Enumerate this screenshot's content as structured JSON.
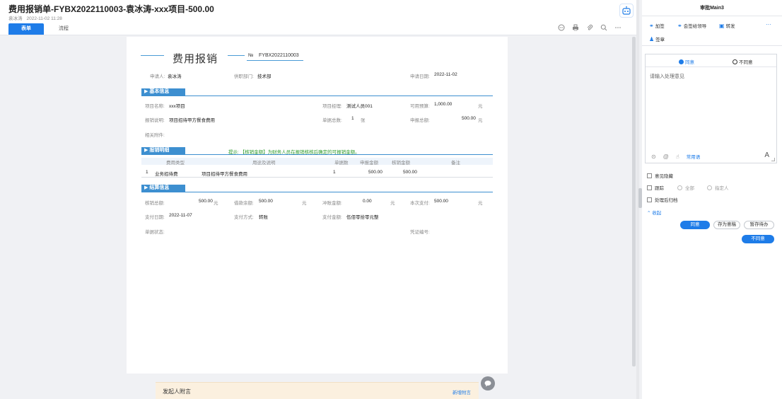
{
  "header": {
    "title": "费用报销单-FYBX2022110003-袁冰涛-xxx项目-500.00",
    "author": "袁冰涛",
    "datetime": "2022-11-02 11:28",
    "tabs": [
      {
        "label": "表单"
      },
      {
        "label": "流程"
      }
    ]
  },
  "form": {
    "title": "费用报销",
    "no_label": "№",
    "no_value": "FYBX2022110003",
    "applicant_label": "申请人:",
    "applicant": "袁冰涛",
    "department_label": "供职部门:",
    "department": "技术部",
    "apply_date_label": "申请日期:",
    "apply_date": "2022-11-02",
    "section_basic": "基本信息",
    "project_name_label": "项目名称:",
    "project_name": "xxx项目",
    "project_manager_label": "项目经理:",
    "project_manager": "测试人员001",
    "available_budget_label": "可用预算:",
    "available_budget": "1,000.00",
    "currency_unit": "元",
    "reason_label": "报销说明:",
    "reason": "项目招待甲方餐食费用",
    "bill_count_label": "单据总数:",
    "bill_count": "1",
    "bill_unit": "张",
    "declared_total_label": "申报总额:",
    "declared_total": "500.00",
    "attachment_label": "相关附件:",
    "section_detail": "报销明细",
    "hint": "提示: 【核销金额】为财务人员在报销核核后确定的可报销金额。",
    "detail_headers": [
      "费用类型",
      "用途及说明",
      "单据数",
      "申报金额",
      "核销金额",
      "备注"
    ],
    "detail_rows": [
      {
        "index": "1",
        "type": "业务招待费",
        "purpose": "项目招待甲方餐食费用",
        "count": "1",
        "declared": "500.00",
        "approved": "500.00"
      }
    ],
    "section_settle": "结算信息",
    "approved_total_label": "核销总额:",
    "approved_total": "500.00",
    "loan_balance_label": "借款余额:",
    "loan_balance": "500.00",
    "offset_label": "冲账金额:",
    "offset": "0.00",
    "this_payment_label": "本次支付:",
    "this_payment": "500.00",
    "pay_date_label": "支付日期:",
    "pay_date": "2022-11-07",
    "pay_method_label": "支付方式:",
    "pay_method": "转账",
    "pay_amount_label": "支付金额:",
    "pay_amount": "伍佰零拾零元整",
    "bill_status_label": "单据状态:",
    "voucher_label": "凭证编号:"
  },
  "comment_bar": {
    "label": "发起人附言",
    "action": "新增附言"
  },
  "panel": {
    "title": "审批Main3",
    "actions": {
      "add_sign": "加签",
      "notify_leader": "会签给领导",
      "forward": "转发",
      "sign": "签章"
    },
    "agree_label": "同意",
    "disagree_label": "不同意",
    "placeholder": "请输入处理意见",
    "common_phrases": "常用语",
    "hide_opinion": "意见隐藏",
    "track": "跟踪",
    "track_all": "全部",
    "track_specified": "指定人",
    "archive_after": "处理后归档",
    "collapse": "收起",
    "btn_agree": "同意",
    "btn_save_opinion": "存为意稿",
    "btn_hold": "暂存待办",
    "btn_disagree": "不同意"
  }
}
